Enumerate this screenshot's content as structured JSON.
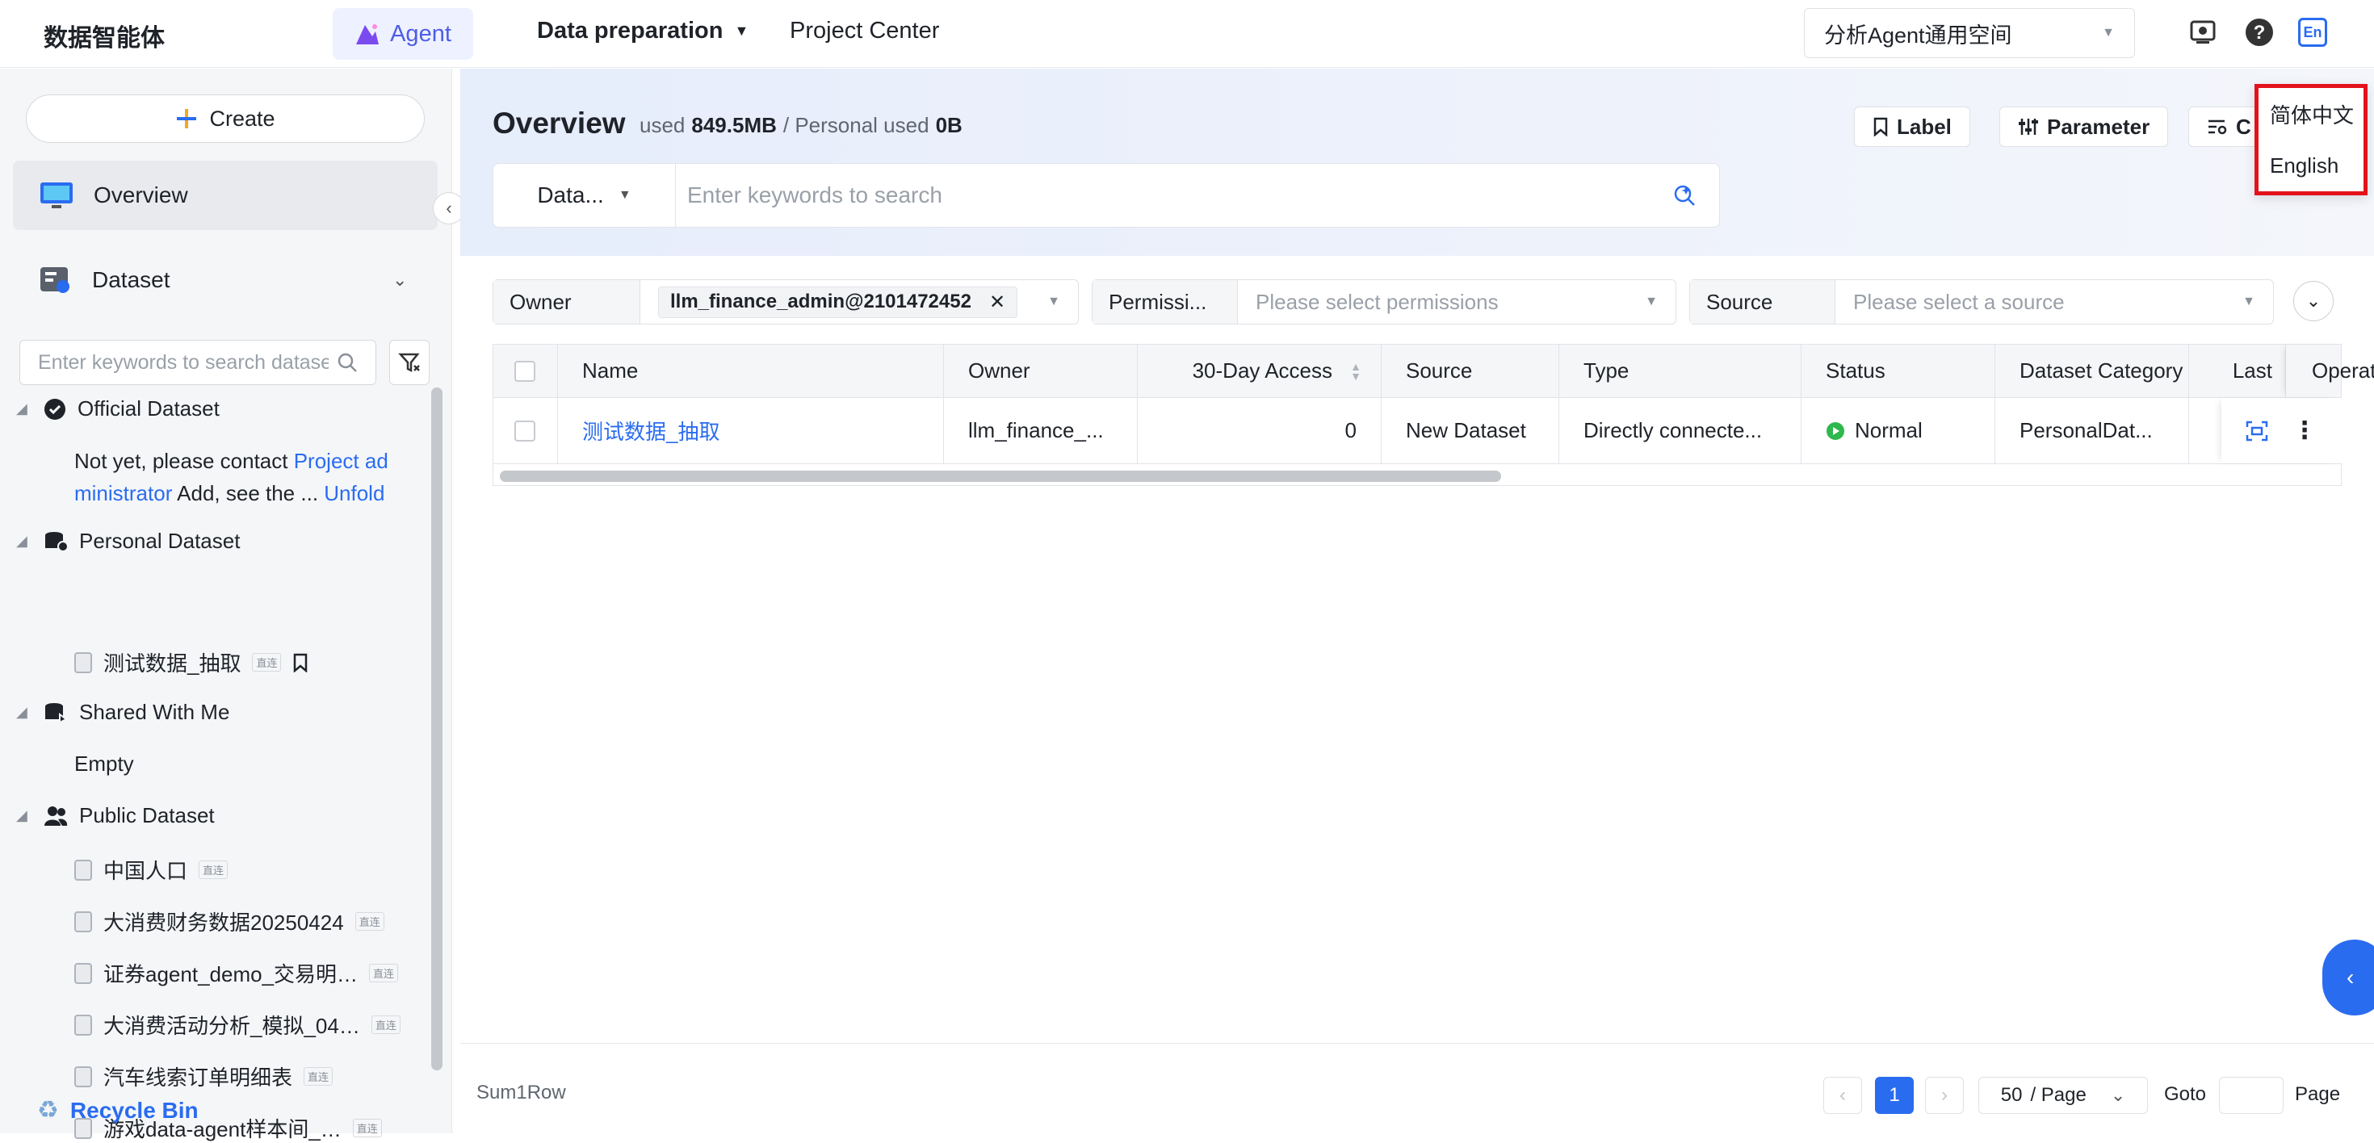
{
  "topbar": {
    "brand": "数据智能体",
    "nav": {
      "agent": "Agent",
      "data_preparation": "Data preparation",
      "project_center": "Project Center"
    },
    "workspace": "分析Agent通用空间",
    "lang_icon": "En"
  },
  "sidebar": {
    "create": "Create",
    "overview": "Overview",
    "dataset": "Dataset",
    "search_placeholder": "Enter keywords to search datasets",
    "groups": {
      "official": {
        "label": "Official Dataset",
        "msg_pre": "Not yet, please contact ",
        "msg_link": "Project ad",
        "msg_link2": "ministrator",
        "msg_post": " Add, see the ... ",
        "unfold": "Unfold"
      },
      "personal": {
        "label": "Personal Dataset",
        "items": [
          {
            "name": "测试数据_抽取",
            "tag": "直连"
          }
        ]
      },
      "shared": {
        "label": "Shared With Me",
        "empty": "Empty"
      },
      "public": {
        "label": "Public Dataset",
        "items": [
          {
            "name": "中国人口",
            "tag": "直连"
          },
          {
            "name": "大消费财务数据20250424",
            "tag": "直连"
          },
          {
            "name": "证券agent_demo_交易明…",
            "tag": "直连"
          },
          {
            "name": "大消费活动分析_模拟_04…",
            "tag": "直连"
          },
          {
            "name": "汽车线索订单明细表",
            "tag": "直连"
          },
          {
            "name": "游戏data-agent样本间_…",
            "tag": "直连"
          }
        ]
      }
    },
    "recycle": "Recycle Bin"
  },
  "main": {
    "title": "Overview",
    "used_label": "used",
    "used_value": "849.5MB",
    "personal_label": "/ Personal used",
    "personal_value": "0B",
    "buttons": {
      "label": "Label",
      "parameter": "Parameter",
      "third": "C"
    },
    "search_scope": "Data...",
    "search_placeholder": "Enter keywords to search",
    "filters": {
      "owner_label": "Owner",
      "owner_value": "llm_finance_admin@2101472452",
      "perm_label": "Permissi...",
      "perm_placeholder": "Please select permissions",
      "source_label": "Source",
      "source_placeholder": "Please select a source"
    },
    "table": {
      "headers": [
        "Name",
        "Owner",
        "30-Day Access",
        "Source",
        "Type",
        "Status",
        "Dataset Category",
        "Last",
        "Operation"
      ],
      "rows": [
        {
          "name": "测试数据_抽取",
          "owner": "llm_finance_...",
          "access": "0",
          "source": "New Dataset",
          "type": "Directly connecte...",
          "status": "Normal",
          "category": "PersonalDat..."
        }
      ]
    },
    "footer": {
      "sum": "Sum1Row",
      "page": "1",
      "page_size": "50",
      "page_size_unit": "/ Page",
      "goto": "Goto",
      "page_label": "Page"
    }
  },
  "lang_menu": {
    "zh": "简体中文",
    "en": "English"
  },
  "colors": {
    "accent": "#2a6cf0",
    "highlight_border": "#e3121b",
    "status_normal": "#2db84d"
  }
}
